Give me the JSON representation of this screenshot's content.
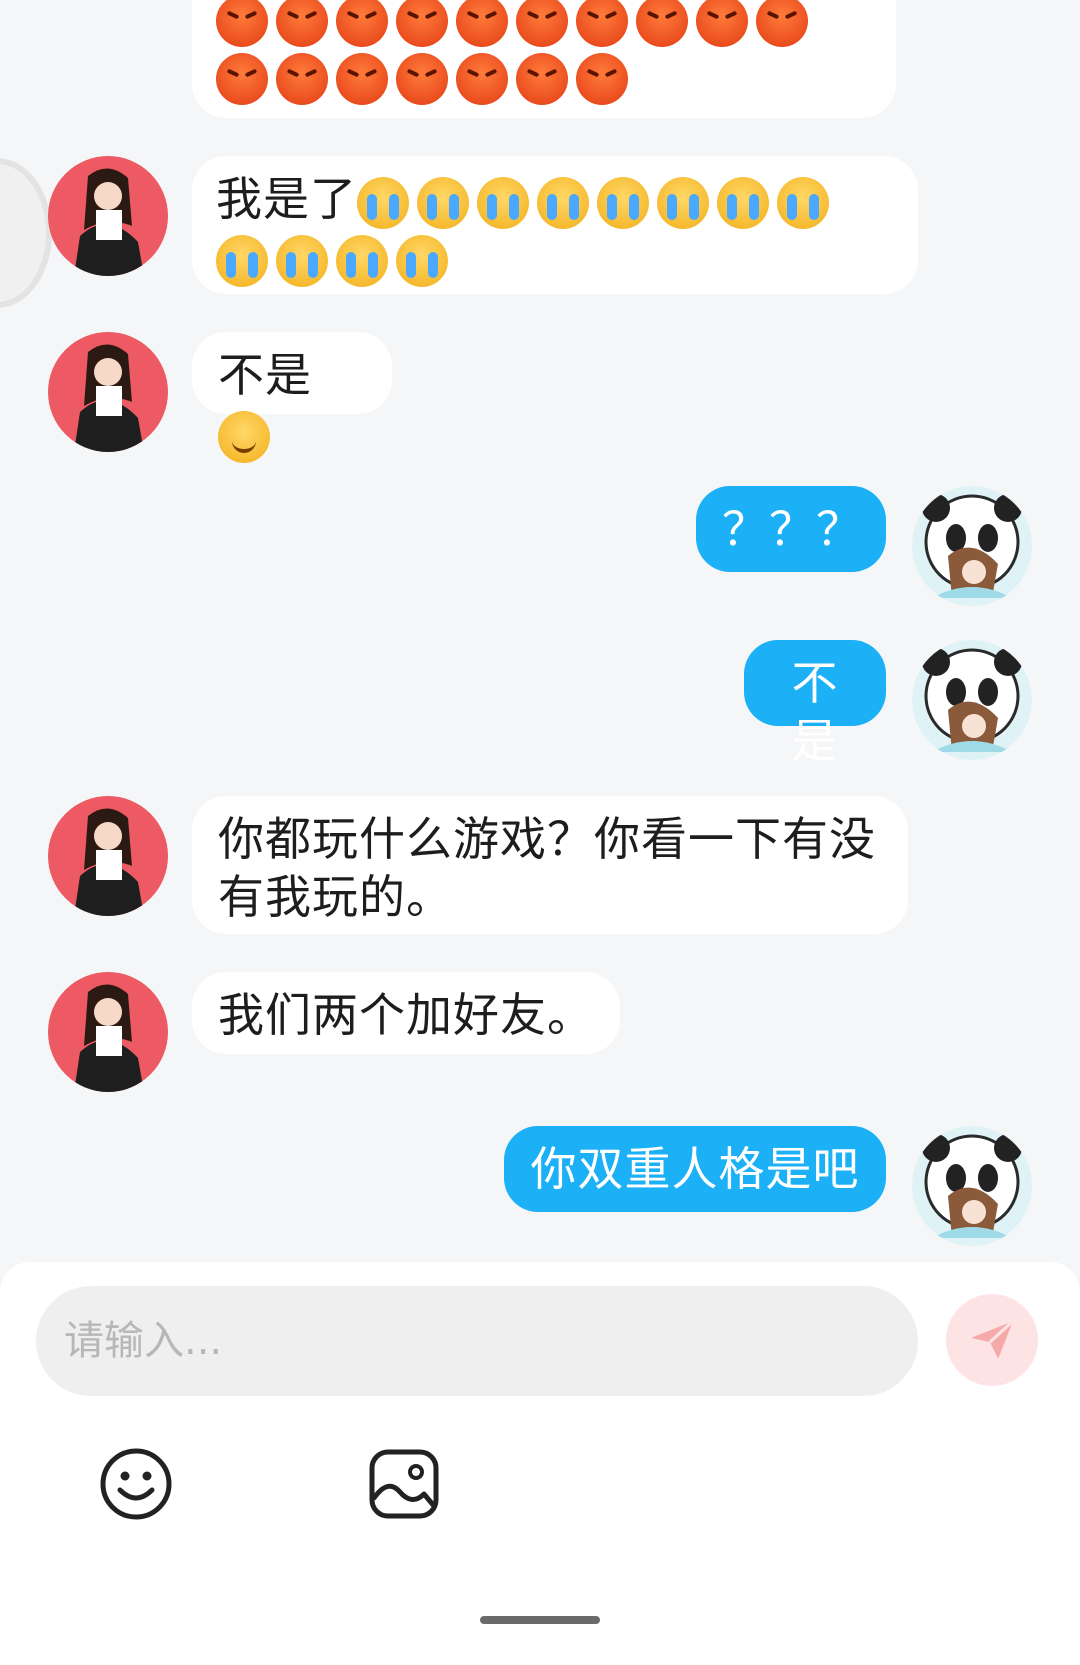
{
  "colors": {
    "accent": "#1cb0f6",
    "incoming_bubble": "#ffffff",
    "background": "#f5f6f8",
    "send_button": "#fde3e3"
  },
  "messages": [
    {
      "side": "in",
      "text": "",
      "emoji": {
        "type": "angry",
        "count": 17
      }
    },
    {
      "side": "in",
      "text": "我是了",
      "emoji": {
        "type": "cry",
        "count": 12
      }
    },
    {
      "side": "in",
      "text": "不是",
      "emoji": {
        "type": "smile",
        "count": 1
      }
    },
    {
      "side": "out",
      "text": "？？？"
    },
    {
      "side": "out",
      "text": "不是"
    },
    {
      "side": "in",
      "text": "你都玩什么游戏？你看一下有没有我玩的。"
    },
    {
      "side": "in",
      "text": "我们两个加好友。"
    },
    {
      "side": "out",
      "text": "你双重人格是吧"
    }
  ],
  "composer": {
    "placeholder": "请输入...",
    "value": "",
    "send_icon": "paper-plane-icon",
    "tools": [
      {
        "name": "emoji-icon"
      },
      {
        "name": "image-icon"
      }
    ]
  }
}
